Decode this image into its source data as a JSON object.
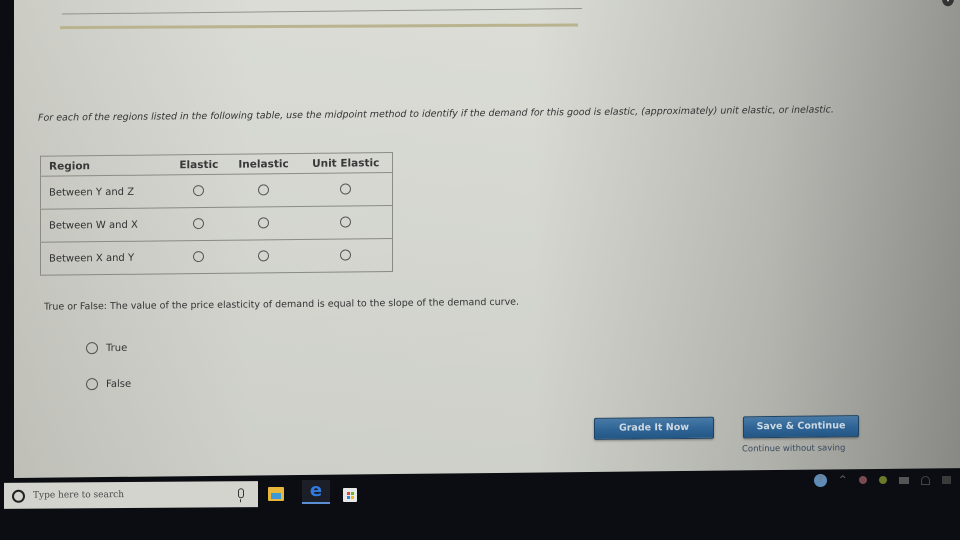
{
  "question1": {
    "prompt": "For each of the regions listed in the following table, use the midpoint method to identify if the demand for this good is elastic, (approximately) unit elastic, or inelastic."
  },
  "table": {
    "headers": [
      "Region",
      "Elastic",
      "Inelastic",
      "Unit Elastic"
    ],
    "rows": [
      {
        "region": "Between Y and Z",
        "selected": null
      },
      {
        "region": "Between W and X",
        "selected": null
      },
      {
        "region": "Between X and Y",
        "selected": null
      }
    ]
  },
  "question2": {
    "prompt": "True or False: The value of the price elasticity of demand is equal to the slope of the demand curve.",
    "options": [
      "True",
      "False"
    ],
    "selected": null
  },
  "actions": {
    "grade_label": "Grade It Now",
    "save_label": "Save & Continue",
    "continue_link": "Continue without saving"
  },
  "taskbar": {
    "search_placeholder": "Type here to search",
    "apps": [
      "file-explorer",
      "edge",
      "store"
    ],
    "edge_glyph": "e"
  },
  "tray": {
    "help_glyph": "?",
    "chevron_glyph": "^"
  },
  "header": {
    "info_glyph": "i"
  },
  "colors": {
    "button_blue": "#2f689c",
    "progress_bar": "#b7b08a",
    "link": "#3b4d62"
  }
}
